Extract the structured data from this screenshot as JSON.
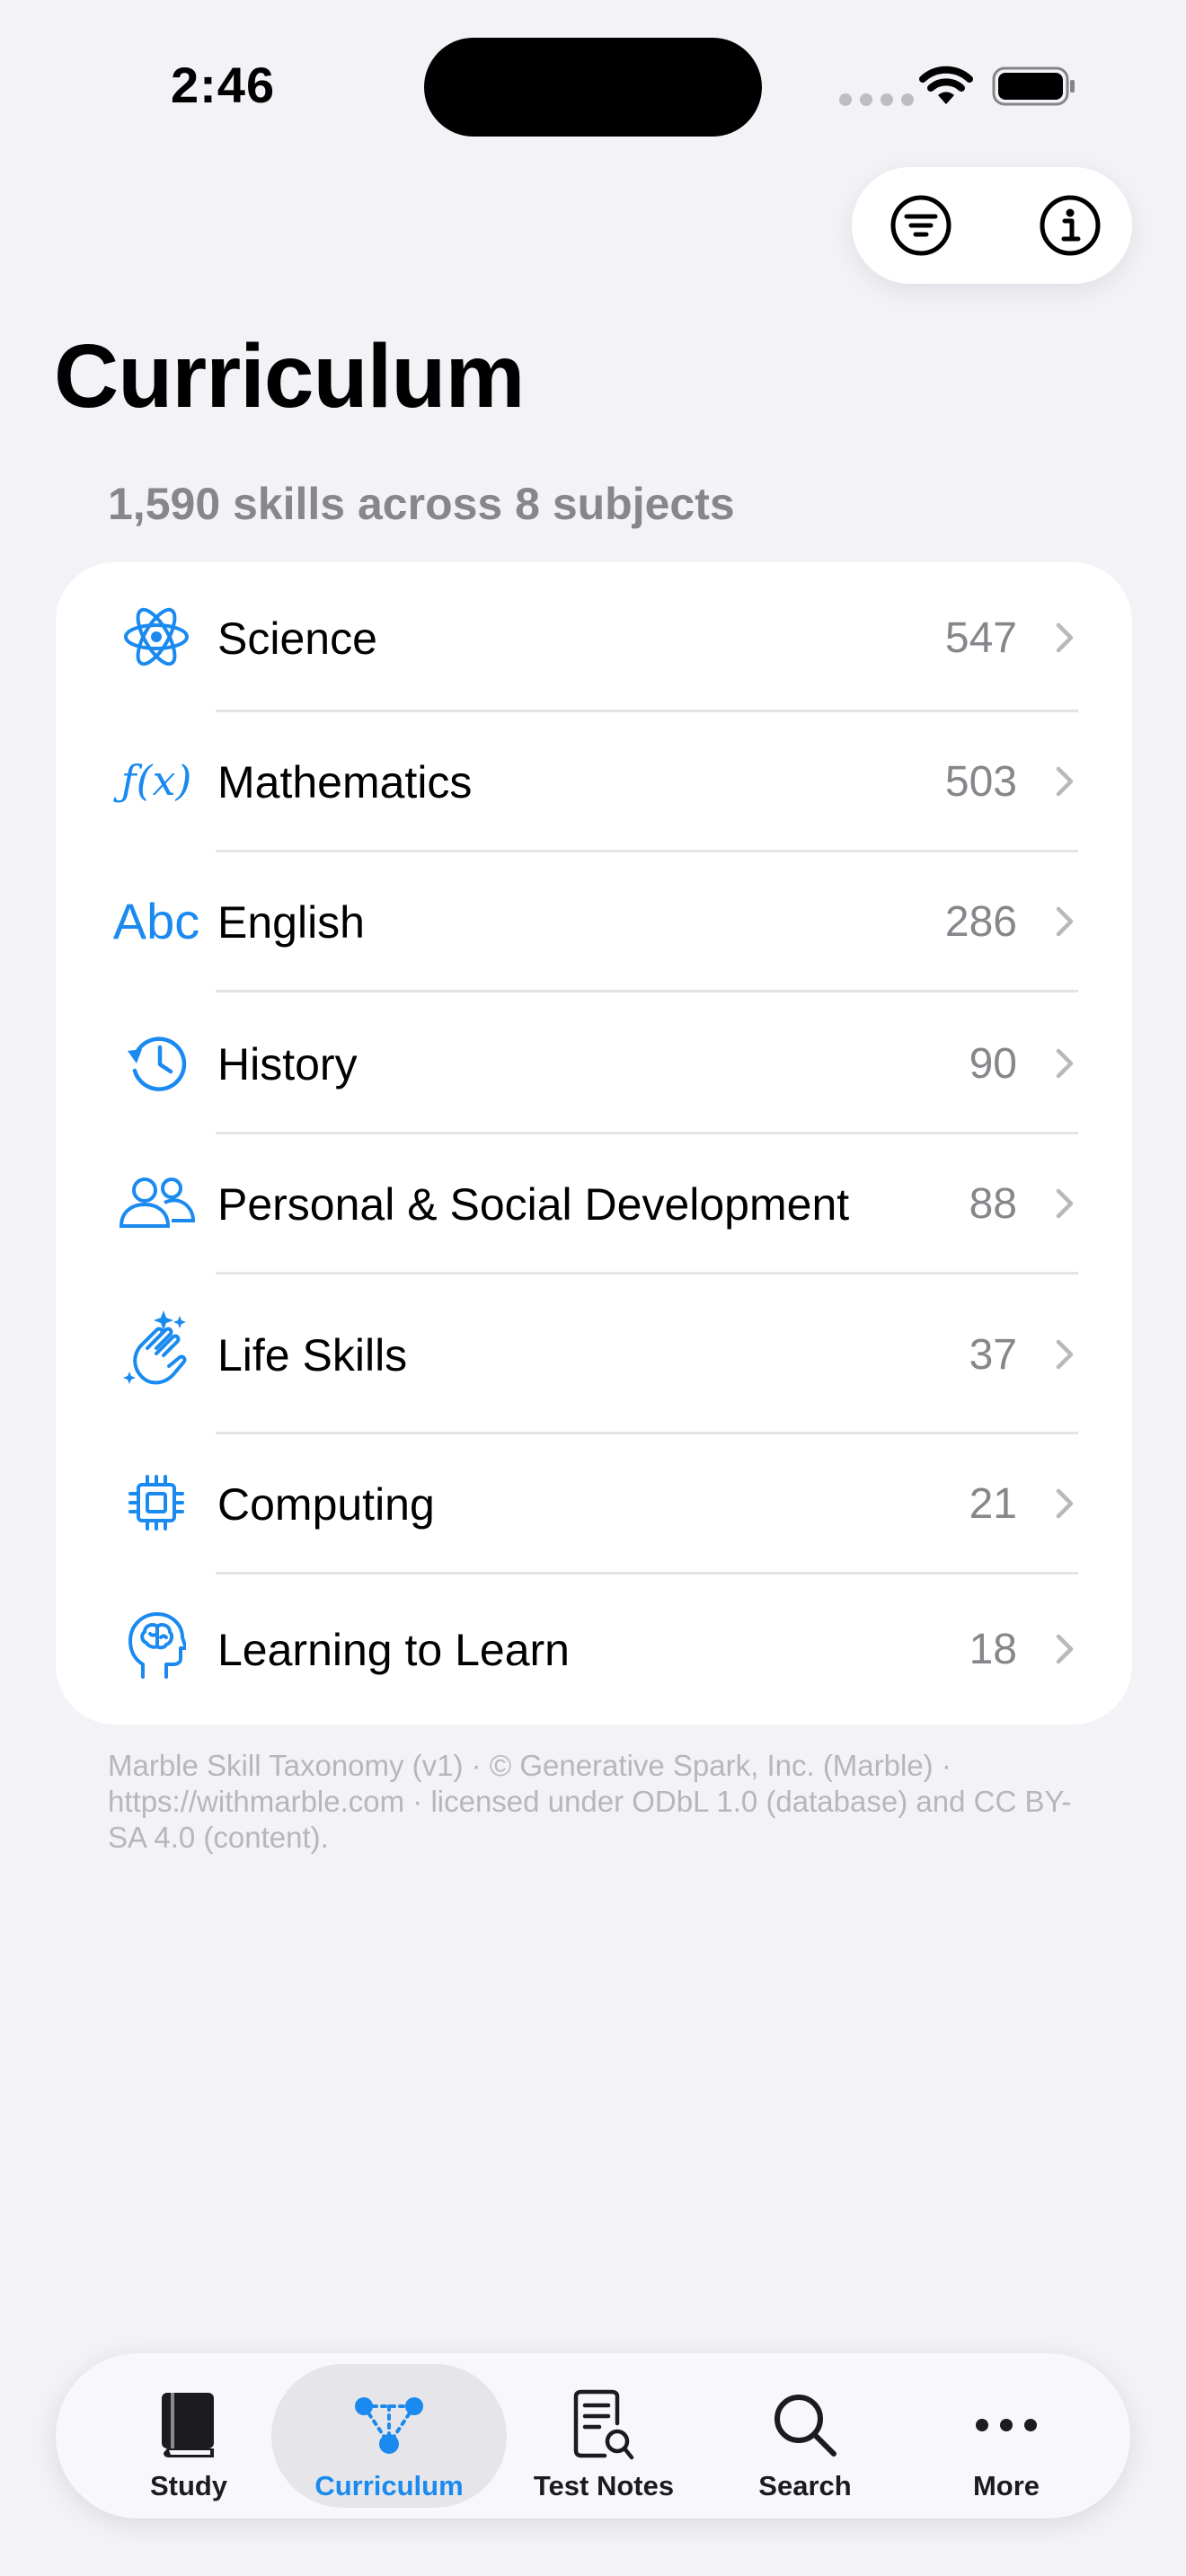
{
  "status_bar": {
    "time": "2:46"
  },
  "header": {
    "title": "Curriculum",
    "subtitle": "1,590 skills across 8 subjects"
  },
  "top_actions": {
    "filter_icon": "filter-circle-icon",
    "info_icon": "info-circle-icon"
  },
  "subjects": [
    {
      "name": "Science",
      "count": "547",
      "icon": "atom-icon"
    },
    {
      "name": "Mathematics",
      "count": "503",
      "icon": "function-icon"
    },
    {
      "name": "English",
      "count": "286",
      "icon": "abc-icon"
    },
    {
      "name": "History",
      "count": "90",
      "icon": "clock-history-icon"
    },
    {
      "name": "Personal & Social Development",
      "count": "88",
      "icon": "people-icon"
    },
    {
      "name": "Life Skills",
      "count": "37",
      "icon": "hands-clap-icon"
    },
    {
      "name": "Computing",
      "count": "21",
      "icon": "cpu-chip-icon"
    },
    {
      "name": "Learning to Learn",
      "count": "18",
      "icon": "brain-head-icon"
    }
  ],
  "footer": {
    "text": "Marble Skill Taxonomy (v1) · © Generative Spark, Inc. (Marble) · https://withmarble.com · licensed under ODbL 1.0 (database) and CC BY-SA 4.0 (content)."
  },
  "tabs": [
    {
      "label": "Study",
      "icon": "book-icon",
      "active": false
    },
    {
      "label": "Curriculum",
      "icon": "graph-nodes-icon",
      "active": true
    },
    {
      "label": "Test Notes",
      "icon": "document-search-icon",
      "active": false
    },
    {
      "label": "Search",
      "icon": "magnifier-icon",
      "active": false
    },
    {
      "label": "More",
      "icon": "ellipsis-icon",
      "active": false
    }
  ],
  "colors": {
    "accent": "#1A8AF0",
    "background": "#F2F2F7",
    "secondary_text": "#86868B"
  }
}
